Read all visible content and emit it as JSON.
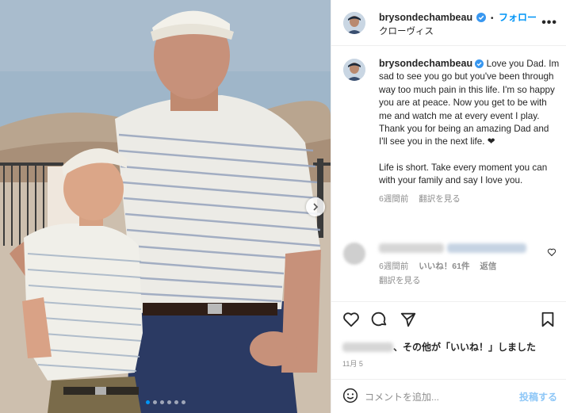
{
  "post": {
    "username": "brysondechambeau",
    "follow_label": "フォロー",
    "separator": "•",
    "location": "クローヴィス",
    "more_icon": "more-horizontal-icon",
    "carousel": {
      "slide_count": 6,
      "active_index": 0
    }
  },
  "caption": {
    "username": "brysondechambeau",
    "paragraph1": "Love you Dad. Im sad to see you go but you've been through way too much pain in this life. I'm so happy you are at peace. Now you get to be with me and watch me at every event I play. Thank you for being an amazing Dad and I'll see you in the next life. ❤",
    "paragraph2": "Life is short. Take every moment you can with your family and say I love you.",
    "time_ago": "6週間前",
    "translate_label": "翻訳を見る"
  },
  "comment": {
    "time_ago": "6週間前",
    "likes_label": "いいね！61件",
    "reply_label": "返信",
    "translate_label": "翻訳を見る"
  },
  "likes": {
    "text": "、その他が「いいね！」しました"
  },
  "date": "11月 5",
  "comment_box": {
    "placeholder": "コメントを追加...",
    "post_label": "投稿する"
  },
  "colors": {
    "accent": "#0095f6",
    "verified": "#3897f0",
    "muted": "#8e8e8e"
  }
}
